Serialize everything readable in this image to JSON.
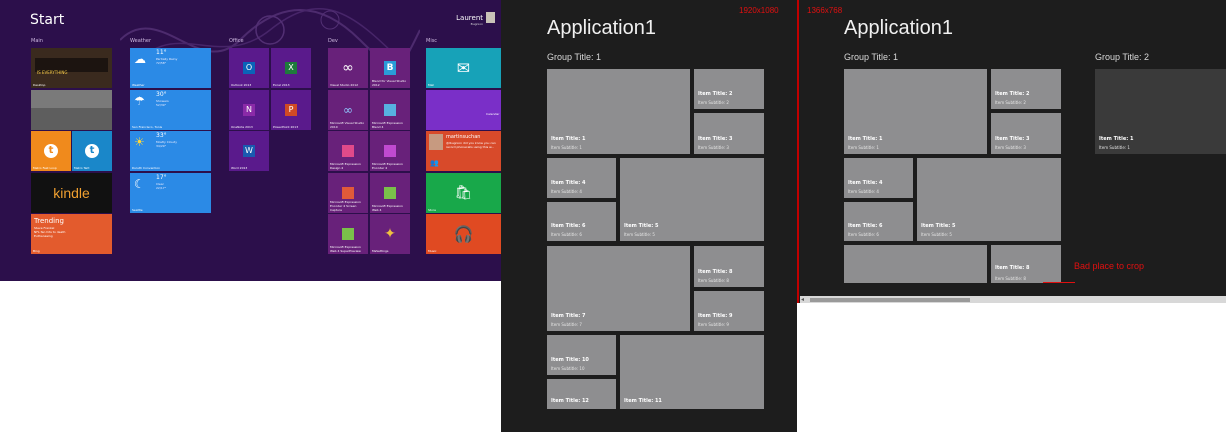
{
  "start": {
    "title": "Start",
    "user": {
      "name": "Laurent",
      "subtitle": "Bugnion"
    },
    "groups": [
      "Main",
      "Weather",
      "Office",
      "Dev",
      "Misc"
    ],
    "tiles": {
      "desktop": "Desktop",
      "desktop_banner": "IS EVERYTHING",
      "metro_fast_loop": "Metro Fast Loop",
      "metro_twit": "Metro Twit",
      "kindle_word": "kindle",
      "trending_title": "Trending",
      "trending_lines": [
        "Steve Frankel",
        "NFL fan hits to death",
        "Euthanasing"
      ],
      "bing": "Bing",
      "weather1": {
        "temp": "11°",
        "lines": [
          "Partially Rainy",
          "72/58°"
        ],
        "label": "Weather"
      },
      "weather2": {
        "temp": "30°",
        "lines": [
          "Showers",
          "52/39°"
        ],
        "label": "San Francisco, Tunis"
      },
      "weather3": {
        "temp": "33°",
        "lines": [
          "Mostly Cloudy",
          "34/29°"
        ],
        "label": "Duluth Convention"
      },
      "weather4": {
        "temp": "17°",
        "lines": [
          "Clear",
          "22/17°"
        ],
        "label": "Seattle"
      },
      "outlook": "Outlook 2013",
      "excel": "Excel 2013",
      "onenote": "OneNote 2013",
      "powerpoint": "PowerPoint 2013",
      "word": "Word 2013",
      "vs2012": "Visual Studio 2012",
      "blend": "Blend for Visual Studio 2012",
      "sql": "Microsoft Visual Studio 2010",
      "expr_blend4": "Microsoft Expression Blend 4",
      "expr_design": "Microsoft Expression Design 4",
      "expr_encoder": "Microsoft Expression Encoder 4",
      "expr_encoder_screen": "Microsoft Expression Encoder 4 Screen Capture",
      "expr_web": "Microsoft Expression Web 4",
      "expr_superpreview": "Microsoft Expression Web 4 SuperPreview",
      "mssettings": "MsSettings",
      "mail": "Mail",
      "calendar": "Calendar",
      "people_name": "martinsuchan",
      "people_text": "@lbugnion did you know you can record phonecalls using this w...",
      "store": "Store",
      "music": "Music"
    }
  },
  "app1": {
    "resolution": "1920x1080",
    "title": "Application1",
    "group_title": "Group Title: 1",
    "items": [
      {
        "title": "Item Title: 1",
        "subtitle": "Item Subtitle: 1"
      },
      {
        "title": "Item Title: 2",
        "subtitle": "Item Subtitle: 2"
      },
      {
        "title": "Item Title: 3",
        "subtitle": "Item Subtitle: 3"
      },
      {
        "title": "Item Title: 4",
        "subtitle": "Item Subtitle: 4"
      },
      {
        "title": "Item Title: 5",
        "subtitle": "Item Subtitle: 5"
      },
      {
        "title": "Item Title: 6",
        "subtitle": "Item Subtitle: 6"
      },
      {
        "title": "Item Title: 7",
        "subtitle": "Item Subtitle: 7"
      },
      {
        "title": "Item Title: 8",
        "subtitle": "Item Subtitle: 8"
      },
      {
        "title": "Item Title: 9",
        "subtitle": "Item Subtitle: 9"
      },
      {
        "title": "Item Title: 10",
        "subtitle": "Item Subtitle: 10"
      },
      {
        "title": "Item Title: 11",
        "subtitle": ""
      },
      {
        "title": "Item Title: 12",
        "subtitle": ""
      }
    ]
  },
  "app2": {
    "resolution": "1366x768",
    "title": "Application1",
    "group_title_1": "Group Title: 1",
    "group_title_2": "Group Title: 2",
    "items": [
      {
        "title": "Item Title: 1",
        "subtitle": "Item Subtitle: 1"
      },
      {
        "title": "Item Title: 2",
        "subtitle": "Item Subtitle: 2"
      },
      {
        "title": "Item Title: 3",
        "subtitle": "Item Subtitle: 3"
      },
      {
        "title": "Item Title: 4",
        "subtitle": "Item Subtitle: 4"
      },
      {
        "title": "Item Title: 6",
        "subtitle": "Item Subtitle: 6"
      },
      {
        "title": "Item Title: 5",
        "subtitle": "Item Subtitle: 5"
      },
      {
        "title": "Item Title: 8",
        "subtitle": "Item Subtitle: 8"
      },
      {
        "title": "Item Title: 1",
        "subtitle": "Item Subtitle: 1"
      }
    ],
    "crop_note": "Bad place to crop"
  }
}
